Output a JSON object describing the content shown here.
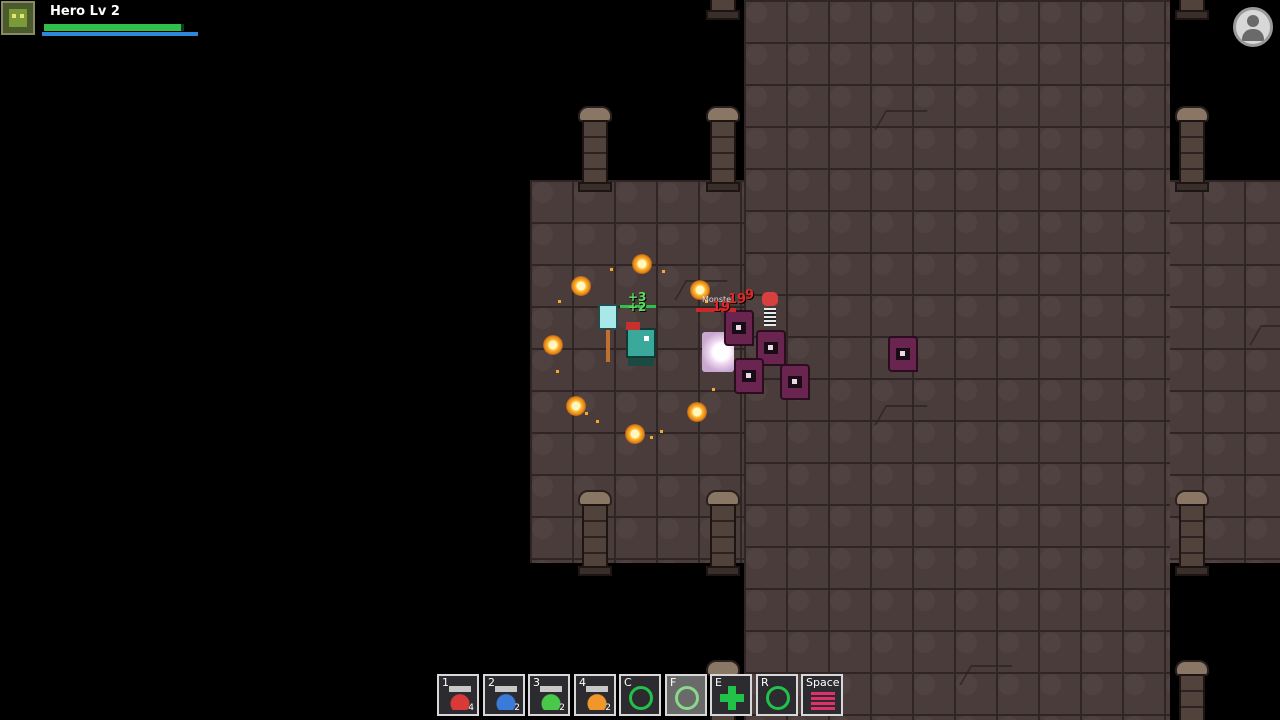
{
  "hud": {
    "player_name": "Hero Lv 2",
    "health_fraction": 0.98,
    "mana_fraction": 1.0,
    "portrait_icon": "goblin-portrait-icon",
    "profile_icon": "user-profile-icon"
  },
  "combat": {
    "damage_numbers": [
      "19",
      "19",
      "9"
    ],
    "heal_numbers": [
      "+3",
      "+2"
    ],
    "monster_label": "Monste"
  },
  "hotbar": {
    "slots": [
      {
        "key": "1",
        "count": "4",
        "icon": "red-potion-icon",
        "color": "#d83a3a"
      },
      {
        "key": "2",
        "count": "2",
        "icon": "blue-potion-icon",
        "color": "#3a7ad8"
      },
      {
        "key": "3",
        "count": "2",
        "icon": "green-potion-icon",
        "color": "#4ac84a"
      },
      {
        "key": "4",
        "count": "2",
        "icon": "orange-potion-icon",
        "color": "#f0962a"
      },
      {
        "key": "C",
        "count": "",
        "icon": "heart-skill-icon",
        "color": "#22c24a"
      },
      {
        "key": "F",
        "count": "",
        "icon": "swirl-skill-icon",
        "color": "#8ad88a"
      },
      {
        "key": "E",
        "count": "",
        "icon": "cross-heal-icon",
        "color": "#22c24a"
      },
      {
        "key": "R",
        "count": "",
        "icon": "ring-skill-icon",
        "color": "#22c24a"
      },
      {
        "key": "Space",
        "count": "",
        "icon": "dash-skill-icon",
        "color": "#e0306a"
      }
    ]
  }
}
